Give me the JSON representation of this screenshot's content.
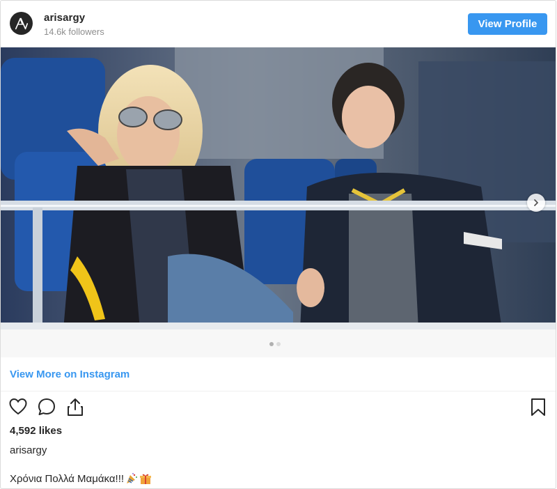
{
  "header": {
    "avatar_icon": "avatar-logo-icon",
    "username": "arisargy",
    "followers": "14.6k followers",
    "view_profile_label": "View Profile"
  },
  "post": {
    "photo_icon": "post-photo",
    "next_icon": "chevron-right-icon",
    "carousel_dots": 2,
    "carousel_active": 1,
    "view_more_label": "View More on Instagram",
    "likes": "4,592 likes",
    "caption_user": "arisargy",
    "caption_text": "Χρόνια Πολλά Μαμάκα!!!",
    "caption_emojis": [
      "party-popper-icon",
      "gift-icon"
    ]
  },
  "icons": {
    "like": "heart-icon",
    "comment": "comment-icon",
    "share": "share-icon",
    "save": "bookmark-icon"
  },
  "colors": {
    "accent": "#3897f0",
    "text": "#262626",
    "muted": "#8e8e8e"
  }
}
